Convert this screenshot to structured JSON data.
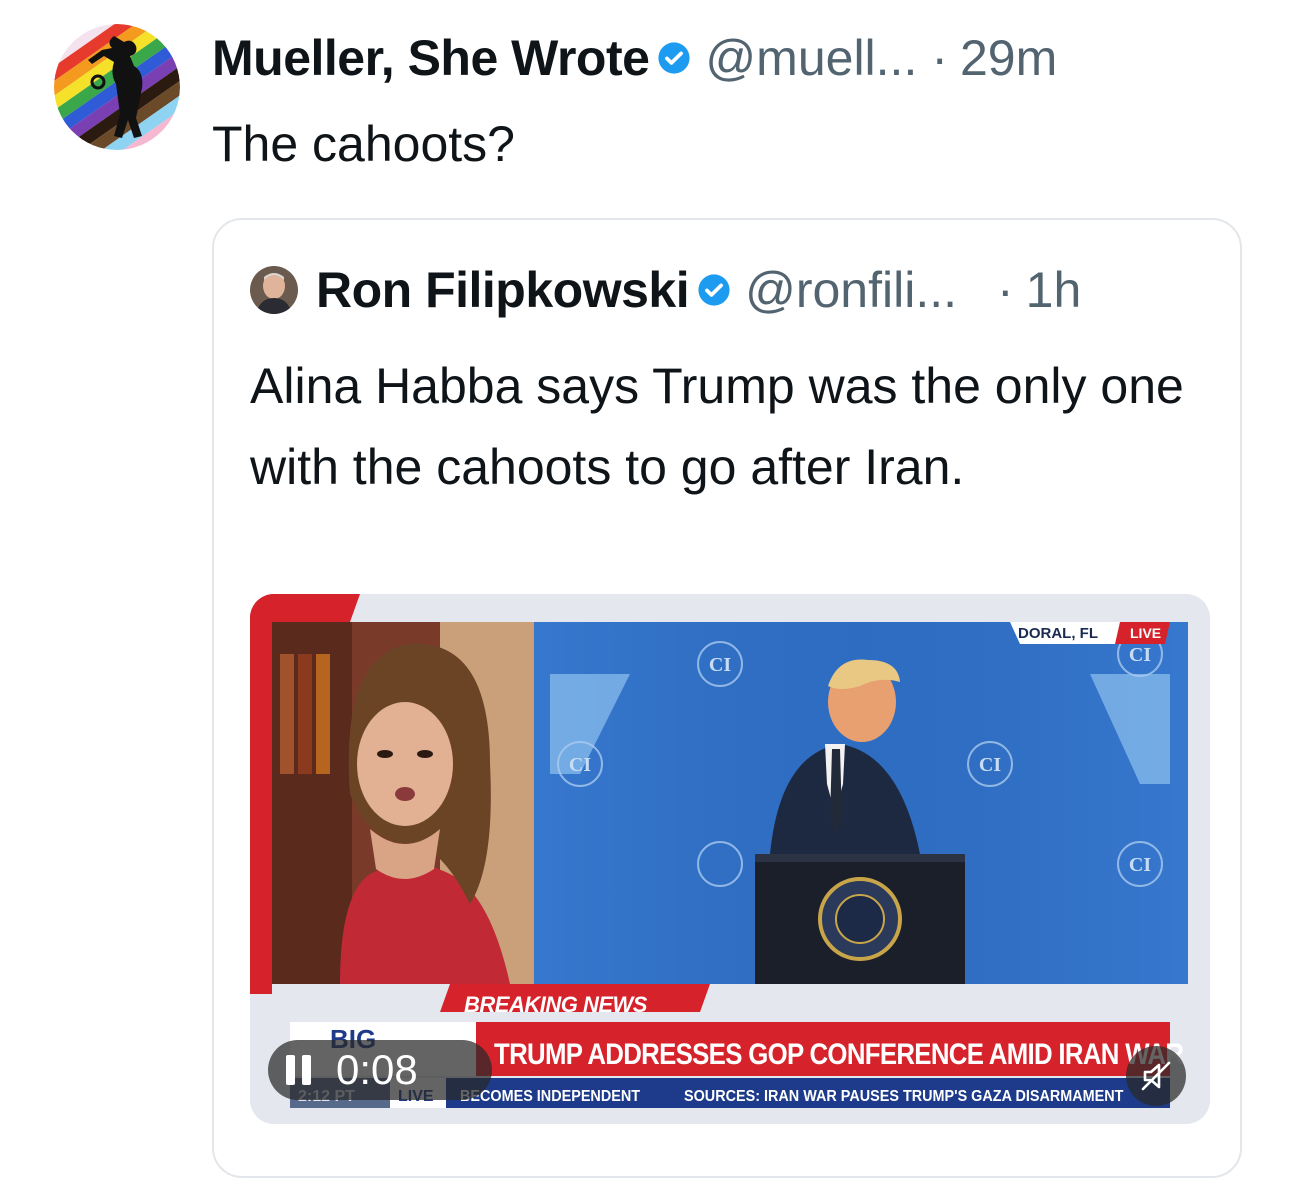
{
  "tweet": {
    "author_name": "Mueller, She Wrote",
    "author_handle": "@muell...",
    "separator": "·",
    "time": "29m",
    "text": "The cahoots?"
  },
  "quoted_tweet": {
    "author_name": "Ron Filipkowski",
    "author_handle": "@ronfili...",
    "separator": "·",
    "time": "1h",
    "text": "Alina Habba says Trump was the only one with the cahoots to go after Iran."
  },
  "video": {
    "elapsed": "0:08",
    "breaking_label": "BREAKING NEWS",
    "headline": "TRUMP ADDRESSES GOP CONFERENCE AMID IRAN WAR",
    "ticker_left": "BECOMES INDEPENDENT",
    "ticker_right": "SOURCES: IRAN WAR PAUSES TRUMP'S GAZA DISARMAMENT",
    "ticker_live": "LIVE",
    "ticker_time": "2:12 PT",
    "show_logo": "BIG",
    "location": "DORAL, FL",
    "live_badge": "LIVE",
    "backdrop_logo": "CI"
  },
  "colors": {
    "verified_blue": "#1d9bf0",
    "secondary_text": "#536471",
    "news_red": "#d6232b",
    "stage_blue": "#2f6fc4"
  },
  "icons": {
    "verified": "verified-badge-icon",
    "pause": "pause-icon",
    "mute": "muted-speaker-icon"
  }
}
